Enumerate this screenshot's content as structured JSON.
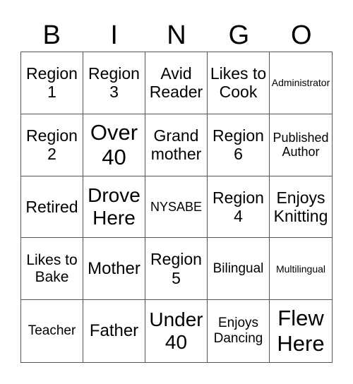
{
  "header": [
    "B",
    "I",
    "N",
    "G",
    "O"
  ],
  "cells": [
    [
      "Region 1",
      "Region 3",
      "Avid Reader",
      "Likes to Cook",
      "Administrator"
    ],
    [
      "Region 2",
      "Over 40",
      "Grand mother",
      "Region 6",
      "Published Author"
    ],
    [
      "Retired",
      "Drove Here",
      "NYSABE",
      "Region 4",
      "Enjoys Knitting"
    ],
    [
      "Likes to Bake",
      "Mother",
      "Region 5",
      "Bilingual",
      "Multilingual"
    ],
    [
      "Teacher",
      "Father",
      "Under 40",
      "Enjoys Dancing",
      "Flew Here"
    ]
  ]
}
